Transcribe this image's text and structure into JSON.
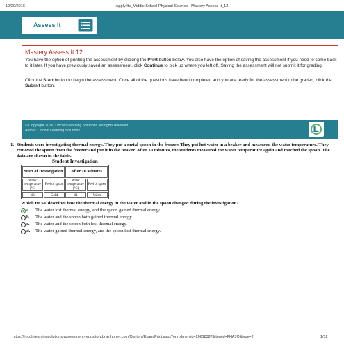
{
  "print_header": {
    "date": "10/20/2016",
    "title": "Apply Its_Middle School Physical Science - Mastery Assess It_12"
  },
  "banner": {
    "label": "Assess It",
    "icon": "checklist-icon",
    "color": "#267f90"
  },
  "main": {
    "title": "Mastery Assess It 12",
    "para1": [
      {
        "text": "You have the option of printing the assessment by clicking the ",
        "bold": false
      },
      {
        "text": "Print",
        "bold": true
      },
      {
        "text": " button below. You also have the option of saving the assessment if you need to come back to it later. If you have previously saved an assessment, click ",
        "bold": false
      },
      {
        "text": "Continue",
        "bold": true
      },
      {
        "text": " to pick up where you left off. Saving the assessment will not submit it for grading.",
        "bold": false
      }
    ],
    "para2": [
      {
        "text": "Click the ",
        "bold": false
      },
      {
        "text": "Start",
        "bold": true
      },
      {
        "text": " button to begin the assessment. Once all of the questions have been completed and you are ready for the assessment to be graded, click the ",
        "bold": false
      },
      {
        "text": "Submit",
        "bold": true
      },
      {
        "text": " button.",
        "bold": false
      }
    ]
  },
  "footer_band": {
    "copyright": "© Copyright 2016. Lincoln Learning Solutions. All rights reserved.",
    "author": "Author:  Lincoln Learning Solutions",
    "logo": "lincoln-learning-logo-icon"
  },
  "question": {
    "number": "1.",
    "text": "Students were investigating thermal energy. They put a metal spoon in the freezer. They put hot water in a beaker and measured the water temperature. They removed the spoon from the freezer and put it in the beaker. After 10 minutes, the students measured the water temperature again and touched the spoon. The data are shown in the table.",
    "table": {
      "title": "Student Investigation",
      "group_headers": [
        "Start of Investigation",
        "After 10 Minutes"
      ],
      "columns": [
        "Water temperature (°C)",
        "Feel of spoon",
        "Water temperature (°C)",
        "Feel of spoon"
      ],
      "rows": [
        [
          "43",
          "Cold",
          "41",
          "Warm"
        ]
      ]
    },
    "prompt": "Which BEST describes how the thermal energy in the water and in the spoon changed during the investigation?",
    "choices": [
      {
        "letter": "a.",
        "text": "The water lost thermal energy, and the spoon gained thermal energy.",
        "selected": true
      },
      {
        "letter": "b.",
        "text": "The water and the spoon both gained thermal energy.",
        "selected": false
      },
      {
        "letter": "c.",
        "text": "The water and the spoon both lost thermal energy.",
        "selected": false
      },
      {
        "letter": "d.",
        "text": "The water gained thermal energy, and the spoon lost thermal energy.",
        "selected": false
      }
    ]
  },
  "print_footer": {
    "url": "https://lincolnlearningsolutions-assessment-repository.brainhoney.com/Content/Exam/Print.aspx?enrollmentid=26618387&itemid=FHA7O&type=2",
    "page": "1/12"
  }
}
